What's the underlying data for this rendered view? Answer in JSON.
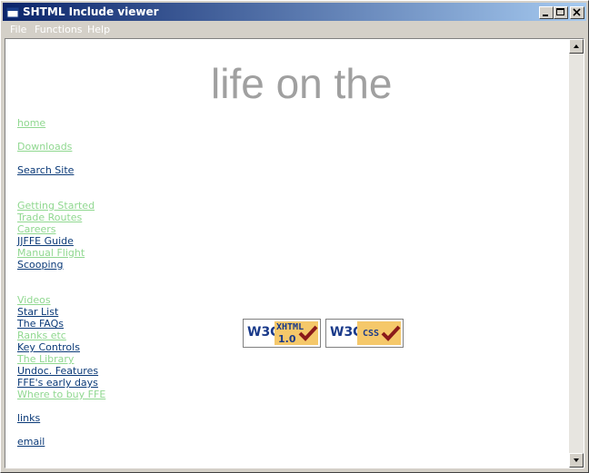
{
  "window": {
    "title": "SHTML Include viewer"
  },
  "menubar": {
    "items": [
      {
        "label": "File"
      },
      {
        "label": "Functions"
      },
      {
        "label": "Help"
      }
    ]
  },
  "content": {
    "heading": "life on the",
    "nav": [
      {
        "label": "home",
        "color": "#90d890"
      },
      {
        "label": "Downloads",
        "color": "#90d890"
      },
      {
        "label": "Search Site",
        "color": "#0b3a78"
      },
      {
        "label": "Getting Started",
        "color": "#90d890"
      },
      {
        "label": "Trade Routes",
        "color": "#90d890"
      },
      {
        "label": "Careers",
        "color": "#90d890"
      },
      {
        "label": "JJFFE Guide",
        "color": "#0b3a78"
      },
      {
        "label": "Manual Flight",
        "color": "#90d890"
      },
      {
        "label": "Scooping",
        "color": "#0b3a78"
      },
      {
        "label": "Videos",
        "color": "#90d890"
      },
      {
        "label": "Star List",
        "color": "#0b3a78"
      },
      {
        "label": "The FAQs",
        "color": "#0b3a78"
      },
      {
        "label": "Ranks etc",
        "color": "#90d890"
      },
      {
        "label": "Key Controls",
        "color": "#0b3a78"
      },
      {
        "label": "The Library",
        "color": "#90d890"
      },
      {
        "label": "Undoc. Features",
        "color": "#0b3a78"
      },
      {
        "label": "FFE's early days",
        "color": "#0b3a78"
      },
      {
        "label": "Where to buy FFE",
        "color": "#90d890"
      },
      {
        "label": "links",
        "color": "#0b3a78"
      },
      {
        "label": "email",
        "color": "#0b3a78"
      }
    ],
    "badges": [
      {
        "w3c": "W3C",
        "label": "XHTML",
        "version": "1.0"
      },
      {
        "w3c": "W3C",
        "label": "CSS",
        "version": ""
      }
    ]
  }
}
